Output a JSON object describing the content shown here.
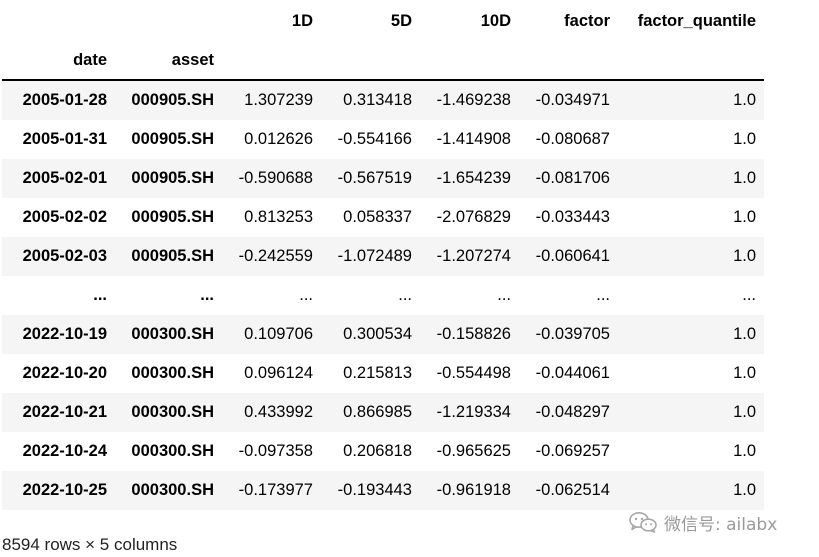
{
  "table": {
    "columns": [
      "1D",
      "5D",
      "10D",
      "factor",
      "factor_quantile"
    ],
    "index_names": [
      "date",
      "asset"
    ],
    "rows": [
      {
        "date": "2005-01-28",
        "asset": "000905.SH",
        "v1D": "1.307239",
        "v5D": "0.313418",
        "v10D": "-1.469238",
        "factor": "-0.034971",
        "factor_quantile": "1.0"
      },
      {
        "date": "2005-01-31",
        "asset": "000905.SH",
        "v1D": "0.012626",
        "v5D": "-0.554166",
        "v10D": "-1.414908",
        "factor": "-0.080687",
        "factor_quantile": "1.0"
      },
      {
        "date": "2005-02-01",
        "asset": "000905.SH",
        "v1D": "-0.590688",
        "v5D": "-0.567519",
        "v10D": "-1.654239",
        "factor": "-0.081706",
        "factor_quantile": "1.0"
      },
      {
        "date": "2005-02-02",
        "asset": "000905.SH",
        "v1D": "0.813253",
        "v5D": "0.058337",
        "v10D": "-2.076829",
        "factor": "-0.033443",
        "factor_quantile": "1.0"
      },
      {
        "date": "2005-02-03",
        "asset": "000905.SH",
        "v1D": "-0.242559",
        "v5D": "-1.072489",
        "v10D": "-1.207274",
        "factor": "-0.060641",
        "factor_quantile": "1.0"
      },
      {
        "date": "...",
        "asset": "...",
        "v1D": "...",
        "v5D": "...",
        "v10D": "...",
        "factor": "...",
        "factor_quantile": "..."
      },
      {
        "date": "2022-10-19",
        "asset": "000300.SH",
        "v1D": "0.109706",
        "v5D": "0.300534",
        "v10D": "-0.158826",
        "factor": "-0.039705",
        "factor_quantile": "1.0"
      },
      {
        "date": "2022-10-20",
        "asset": "000300.SH",
        "v1D": "0.096124",
        "v5D": "0.215813",
        "v10D": "-0.554498",
        "factor": "-0.044061",
        "factor_quantile": "1.0"
      },
      {
        "date": "2022-10-21",
        "asset": "000300.SH",
        "v1D": "0.433992",
        "v5D": "0.866985",
        "v10D": "-1.219334",
        "factor": "-0.048297",
        "factor_quantile": "1.0"
      },
      {
        "date": "2022-10-24",
        "asset": "000300.SH",
        "v1D": "-0.097358",
        "v5D": "0.206818",
        "v10D": "-0.965625",
        "factor": "-0.069257",
        "factor_quantile": "1.0"
      },
      {
        "date": "2022-10-25",
        "asset": "000300.SH",
        "v1D": "-0.173977",
        "v5D": "-0.193443",
        "v10D": "-0.961918",
        "factor": "-0.062514",
        "factor_quantile": "1.0"
      }
    ]
  },
  "footer": {
    "shape_text": "8594 rows × 5 columns"
  },
  "watermark": {
    "text": "微信号: ailabx",
    "icon": "wechat-icon"
  },
  "colors": {
    "stripe": "#f5f5f5",
    "header_rule": "#000000",
    "watermark": "#9a9a9a"
  }
}
